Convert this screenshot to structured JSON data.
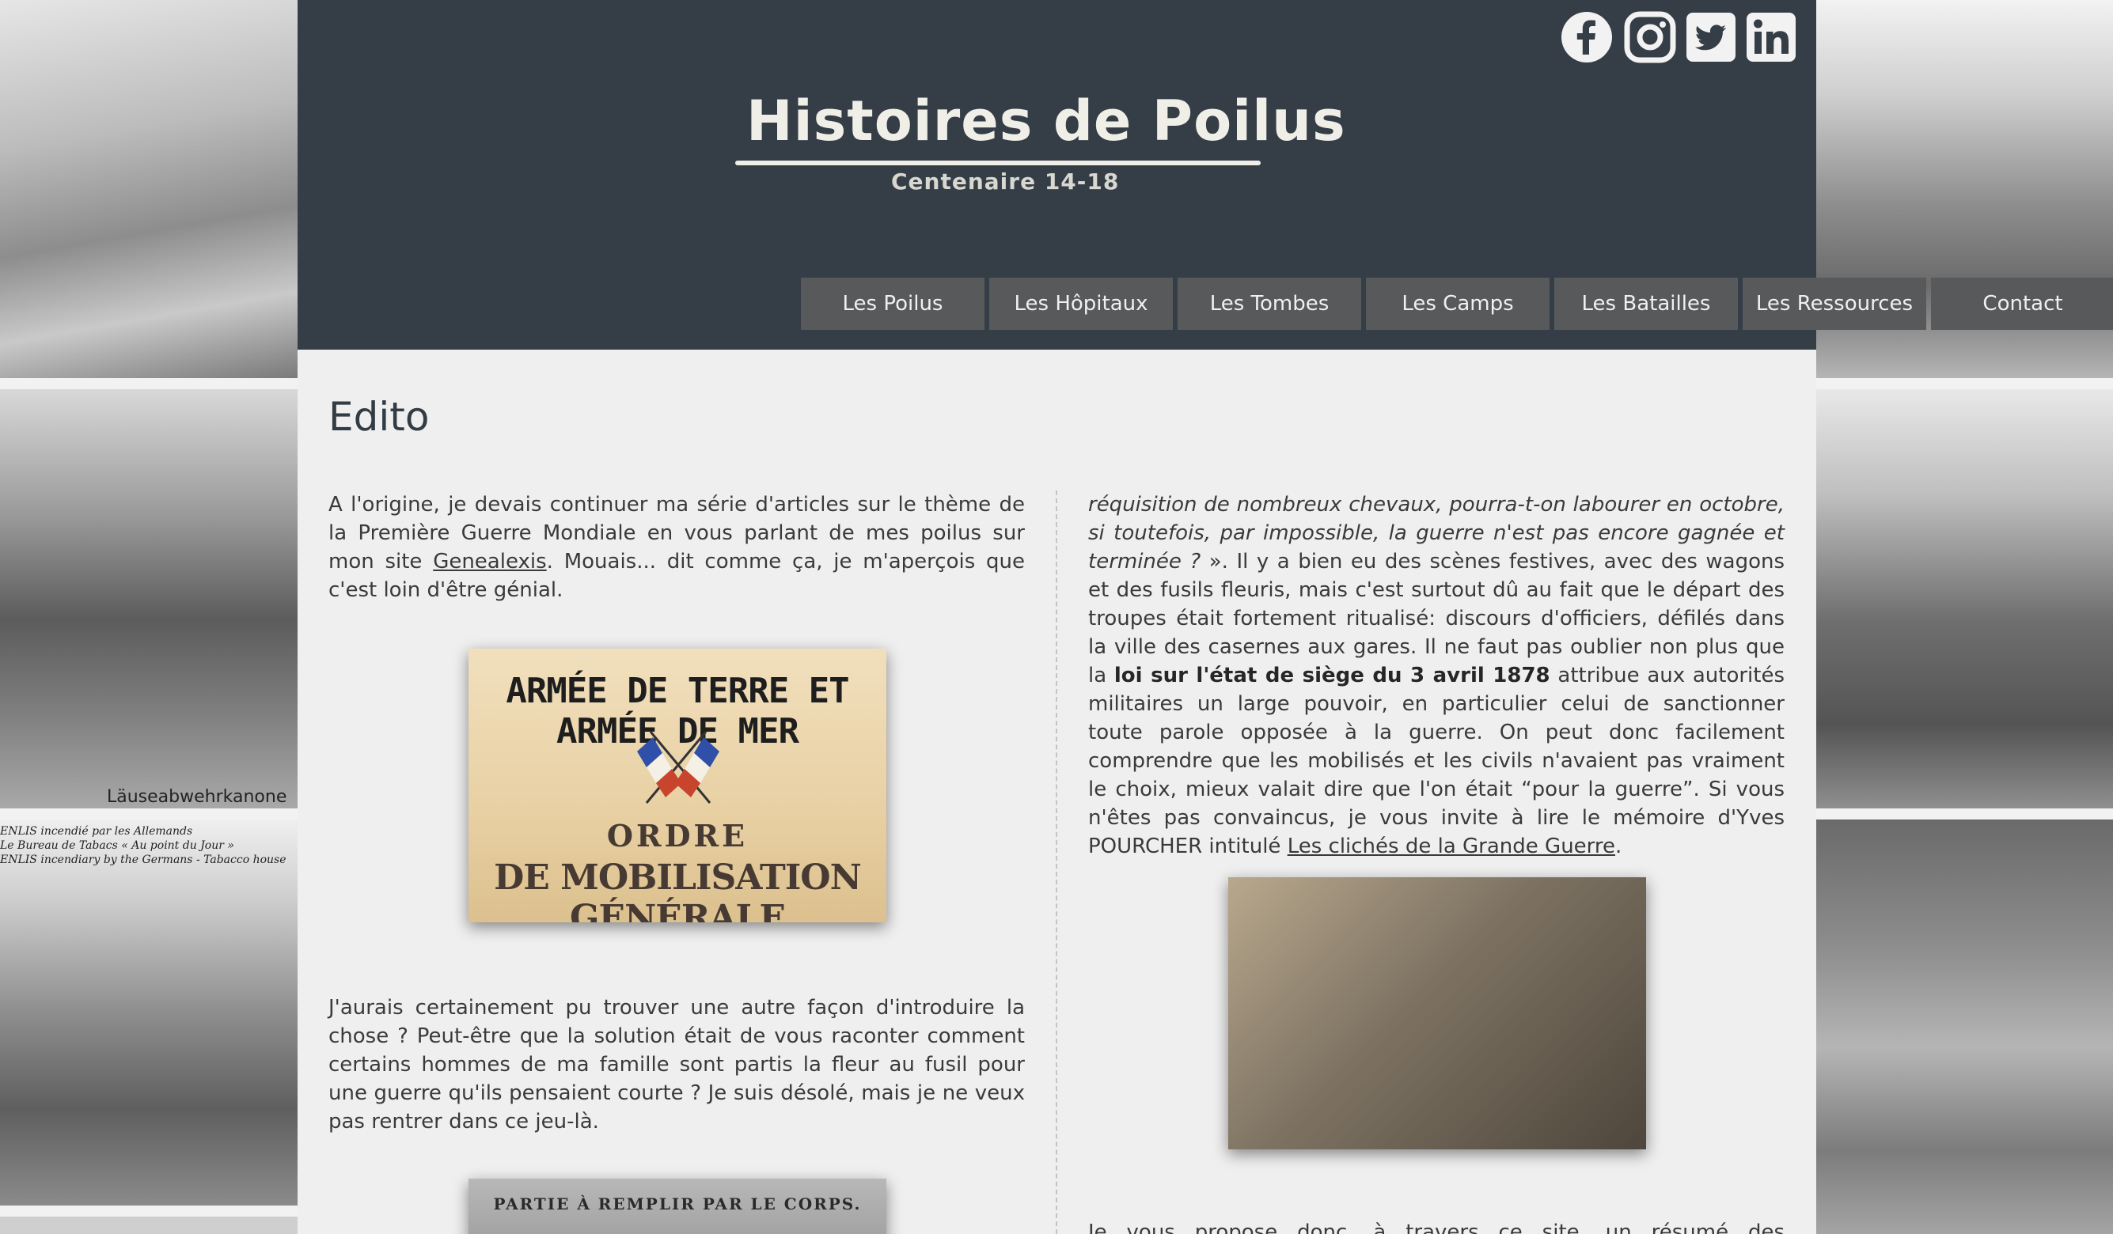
{
  "header": {
    "logo_title": "Histoires de Poilus",
    "logo_subtitle": "Centenaire 14-18",
    "social": [
      {
        "name": "facebook-icon"
      },
      {
        "name": "instagram-icon"
      },
      {
        "name": "twitter-icon"
      },
      {
        "name": "linkedin-icon"
      }
    ]
  },
  "nav": {
    "items": [
      {
        "label": "Les Poilus"
      },
      {
        "label": "Les Hôpitaux"
      },
      {
        "label": "Les Tombes"
      },
      {
        "label": "Les Camps"
      },
      {
        "label": "Les Batailles"
      },
      {
        "label": "Les Ressources"
      },
      {
        "label": "Contact"
      }
    ]
  },
  "content": {
    "title": "Edito",
    "left_p1_before": "A l'origine, je devais continuer ma série d'articles sur le thème de la Première Guerre Mondiale en vous parlant de mes poilus sur mon site ",
    "left_p1_link": "Genealexis",
    "left_p1_after": ". Mouais... dit comme ça, je m'aperçois que c'est loin d'être génial.",
    "poster1_line1": "ARMÉE DE TERRE ET ARMÉE DE MER",
    "poster1_line2": "ORDRE",
    "poster1_line3": "DE MOBILISATION GÉNÉRALE",
    "left_p2": "J'aurais certainement pu trouver une autre façon d'introduire la chose ? Peut-être que la solution était de vous raconter comment certains hommes de ma famille sont partis la fleur au fusil pour une guerre qu'ils pensaient courte ? Je suis désolé, mais je ne veux pas rentrer dans ce jeu-là.",
    "poster3_line1": "PARTIE À REMPLIR PAR LE CORPS.",
    "right_p1_italic": "réquisition de nombreux chevaux, pourra-t-on labourer en octobre, si toutefois, par impossible, la guerre n'est pas encore gagnée et terminée ?",
    "right_p1_a": " ». Il y a bien eu des scènes festives, avec des wagons et des fusils fleuris, mais c'est surtout dû au fait que le départ des troupes était fortement ritualisé: discours d'officiers, défilés dans la ville des casernes aux gares. Il ne faut pas oublier non plus que la ",
    "right_p1_bold": "loi sur l'état de siège du 3 avril 1878",
    "right_p1_b": " attribue aux autorités militaires un large pouvoir, en particulier celui de sanctionner toute parole opposée à la guerre. On peut donc facilement comprendre que les mobilisés et les civils n'avaient pas vraiment le choix, mieux valait dire que l'on était “pour la guerre”. Si vous n'êtes pas convaincus, je vous invite à lire le mémoire d'Yves POURCHER intitulé ",
    "right_p1_link": "Les clichés de la Grande Guerre",
    "right_p1_end": ".",
    "right_p2": "Je vous propose donc, à travers ce site, un résumé des découvertes que"
  },
  "colors": {
    "header_bg": "#353d47",
    "nav_bg": "#58595b",
    "content_bg": "#efefef",
    "title_color": "#333b44"
  }
}
